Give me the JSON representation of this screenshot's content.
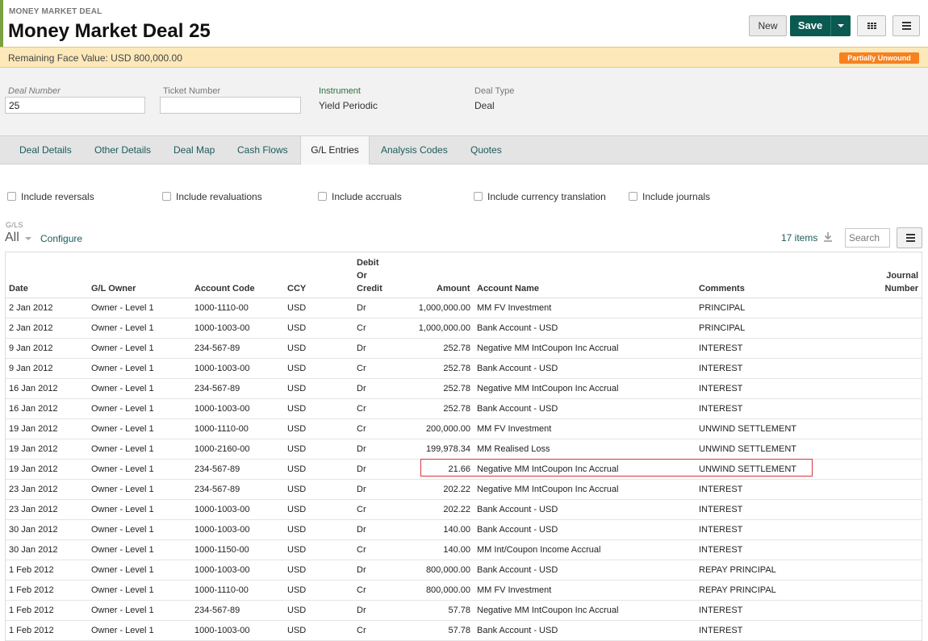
{
  "header": {
    "supertitle": "MONEY MARKET DEAL",
    "title": "Money Market Deal 25",
    "new_label": "New",
    "save_label": "Save"
  },
  "banner": {
    "text": "Remaining Face Value: USD 800,000.00",
    "badge": "Partially Unwound"
  },
  "fields": {
    "deal_number_label": "Deal Number",
    "deal_number_value": "25",
    "ticket_number_label": "Ticket Number",
    "ticket_number_value": "",
    "instrument_label": "Instrument",
    "instrument_value": "Yield Periodic",
    "deal_type_label": "Deal Type",
    "deal_type_value": "Deal"
  },
  "tabs": [
    {
      "label": "Deal Details"
    },
    {
      "label": "Other Details"
    },
    {
      "label": "Deal Map"
    },
    {
      "label": "Cash Flows"
    },
    {
      "label": "G/L Entries"
    },
    {
      "label": "Analysis Codes"
    },
    {
      "label": "Quotes"
    }
  ],
  "filters": [
    {
      "label": "Include reversals"
    },
    {
      "label": "Include revaluations"
    },
    {
      "label": "Include accruals"
    },
    {
      "label": "Include currency translation"
    },
    {
      "label": "Include journals"
    }
  ],
  "gls": {
    "label": "G/LS",
    "value": "All",
    "configure": "Configure"
  },
  "list": {
    "count": "17 items",
    "search_placeholder": "Search"
  },
  "columns": {
    "date": "Date",
    "owner": "G/L Owner",
    "account_code": "Account Code",
    "ccy": "CCY",
    "debit_line1": "Debit",
    "debit_line2": "Or",
    "debit_line3": "Credit",
    "amount": "Amount",
    "account_name": "Account Name",
    "comments": "Comments",
    "journal_line1": "Journal",
    "journal_line2": "Number"
  },
  "rows": [
    {
      "date": "2 Jan 2012",
      "owner": "Owner - Level 1",
      "code": "1000-1110-00",
      "ccy": "USD",
      "dc": "Dr",
      "amount": "1,000,000.00",
      "name": "MM FV Investment",
      "comments": "PRINCIPAL"
    },
    {
      "date": "2 Jan 2012",
      "owner": "Owner - Level 1",
      "code": "1000-1003-00",
      "ccy": "USD",
      "dc": "Cr",
      "amount": "1,000,000.00",
      "name": "Bank Account - USD",
      "comments": "PRINCIPAL"
    },
    {
      "date": "9 Jan 2012",
      "owner": "Owner - Level 1",
      "code": "234-567-89",
      "ccy": "USD",
      "dc": "Dr",
      "amount": "252.78",
      "name": "Negative MM IntCoupon Inc Accrual",
      "comments": "INTEREST"
    },
    {
      "date": "9 Jan 2012",
      "owner": "Owner - Level 1",
      "code": "1000-1003-00",
      "ccy": "USD",
      "dc": "Cr",
      "amount": "252.78",
      "name": "Bank Account - USD",
      "comments": "INTEREST"
    },
    {
      "date": "16 Jan 2012",
      "owner": "Owner - Level 1",
      "code": "234-567-89",
      "ccy": "USD",
      "dc": "Dr",
      "amount": "252.78",
      "name": "Negative MM IntCoupon Inc Accrual",
      "comments": "INTEREST"
    },
    {
      "date": "16 Jan 2012",
      "owner": "Owner - Level 1",
      "code": "1000-1003-00",
      "ccy": "USD",
      "dc": "Cr",
      "amount": "252.78",
      "name": "Bank Account - USD",
      "comments": "INTEREST"
    },
    {
      "date": "19 Jan 2012",
      "owner": "Owner - Level 1",
      "code": "1000-1110-00",
      "ccy": "USD",
      "dc": "Cr",
      "amount": "200,000.00",
      "name": "MM FV Investment",
      "comments": "UNWIND SETTLEMENT"
    },
    {
      "date": "19 Jan 2012",
      "owner": "Owner - Level 1",
      "code": "1000-2160-00",
      "ccy": "USD",
      "dc": "Dr",
      "amount": "199,978.34",
      "name": "MM Realised Loss",
      "comments": "UNWIND SETTLEMENT"
    },
    {
      "date": "19 Jan 2012",
      "owner": "Owner - Level 1",
      "code": "234-567-89",
      "ccy": "USD",
      "dc": "Dr",
      "amount": "21.66",
      "name": "Negative MM IntCoupon Inc Accrual",
      "comments": "UNWIND SETTLEMENT"
    },
    {
      "date": "23 Jan 2012",
      "owner": "Owner - Level 1",
      "code": "234-567-89",
      "ccy": "USD",
      "dc": "Dr",
      "amount": "202.22",
      "name": "Negative MM IntCoupon Inc Accrual",
      "comments": "INTEREST"
    },
    {
      "date": "23 Jan 2012",
      "owner": "Owner - Level 1",
      "code": "1000-1003-00",
      "ccy": "USD",
      "dc": "Cr",
      "amount": "202.22",
      "name": "Bank Account - USD",
      "comments": "INTEREST"
    },
    {
      "date": "30 Jan 2012",
      "owner": "Owner - Level 1",
      "code": "1000-1003-00",
      "ccy": "USD",
      "dc": "Dr",
      "amount": "140.00",
      "name": "Bank Account - USD",
      "comments": "INTEREST"
    },
    {
      "date": "30 Jan 2012",
      "owner": "Owner - Level 1",
      "code": "1000-1150-00",
      "ccy": "USD",
      "dc": "Cr",
      "amount": "140.00",
      "name": "MM Int/Coupon Income Accrual",
      "comments": "INTEREST"
    },
    {
      "date": "1 Feb 2012",
      "owner": "Owner - Level 1",
      "code": "1000-1003-00",
      "ccy": "USD",
      "dc": "Dr",
      "amount": "800,000.00",
      "name": "Bank Account - USD",
      "comments": "REPAY PRINCIPAL"
    },
    {
      "date": "1 Feb 2012",
      "owner": "Owner - Level 1",
      "code": "1000-1110-00",
      "ccy": "USD",
      "dc": "Cr",
      "amount": "800,000.00",
      "name": "MM FV Investment",
      "comments": "REPAY PRINCIPAL"
    },
    {
      "date": "1 Feb 2012",
      "owner": "Owner - Level 1",
      "code": "234-567-89",
      "ccy": "USD",
      "dc": "Dr",
      "amount": "57.78",
      "name": "Negative MM IntCoupon Inc Accrual",
      "comments": "INTEREST"
    },
    {
      "date": "1 Feb 2012",
      "owner": "Owner - Level 1",
      "code": "1000-1003-00",
      "ccy": "USD",
      "dc": "Cr",
      "amount": "57.78",
      "name": "Bank Account - USD",
      "comments": "INTEREST"
    }
  ]
}
